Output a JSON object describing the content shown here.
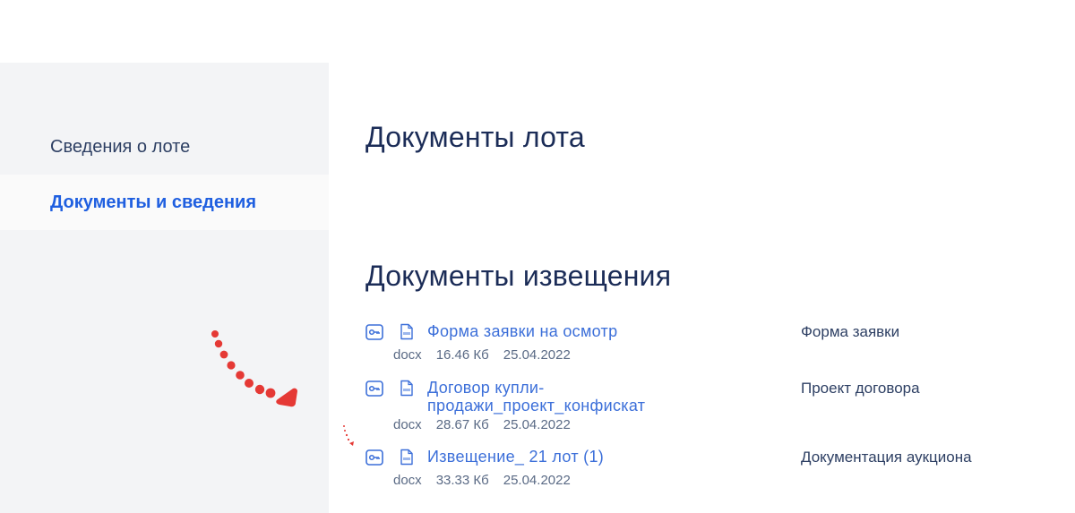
{
  "sidebar": {
    "items": [
      {
        "label": "Сведения о лоте",
        "active": false
      },
      {
        "label": "Документы и сведения",
        "active": true
      }
    ]
  },
  "main": {
    "lot_documents_title": "Документы лота",
    "notice_documents_title": "Документы извещения",
    "documents": [
      {
        "name": "Форма заявки на осмотр",
        "ext": "docx",
        "size": "16.46 Кб",
        "date": "25.04.2022",
        "category": "Форма заявки"
      },
      {
        "name": "Договор купли-продажи_проект_конфискат",
        "ext": "docx",
        "size": "28.67 Кб",
        "date": "25.04.2022",
        "category": "Проект договора"
      },
      {
        "name": "Извещение_ 21 лот (1)",
        "ext": "docx",
        "size": "33.33 Кб",
        "date": "25.04.2022",
        "category": "Документация аукциона"
      }
    ]
  },
  "colors": {
    "accent": "#1f5fe0",
    "link": "#3c6fd9",
    "heading": "#1b2c57",
    "sidebar_bg": "#f3f4f6",
    "annotation_arrow": "#e53935"
  },
  "icons": [
    "key-icon",
    "file-icon",
    "arrow-annotation"
  ]
}
